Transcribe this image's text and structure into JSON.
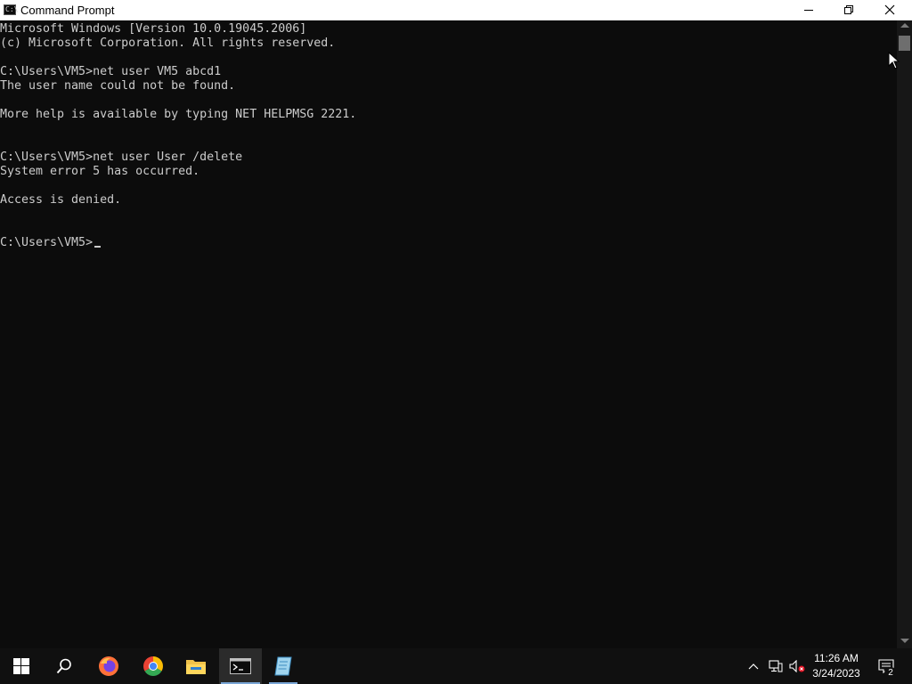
{
  "window": {
    "title": "Command Prompt",
    "icon_text": "C:\\"
  },
  "console": {
    "lines": [
      "Microsoft Windows [Version 10.0.19045.2006]",
      "(c) Microsoft Corporation. All rights reserved.",
      "",
      "C:\\Users\\VM5>net user VM5 abcd1",
      "The user name could not be found.",
      "",
      "More help is available by typing NET HELPMSG 2221.",
      "",
      "",
      "C:\\Users\\VM5>net user User /delete",
      "System error 5 has occurred.",
      "",
      "Access is denied.",
      "",
      ""
    ],
    "prompt": "C:\\Users\\VM5>"
  },
  "taskbar": {
    "apps": [
      "start-icon",
      "search-icon",
      "firefox-icon",
      "chrome-icon",
      "file-explorer-icon",
      "command-prompt-icon",
      "notepad-icon"
    ],
    "clock": {
      "time": "11:26 AM",
      "date": "3/24/2023"
    },
    "notification_count": "2"
  },
  "colors": {
    "console_bg": "#0c0c0c",
    "console_text": "#cccccc",
    "taskbar_bg": "#101010",
    "titlebar_bg": "#ffffff"
  }
}
